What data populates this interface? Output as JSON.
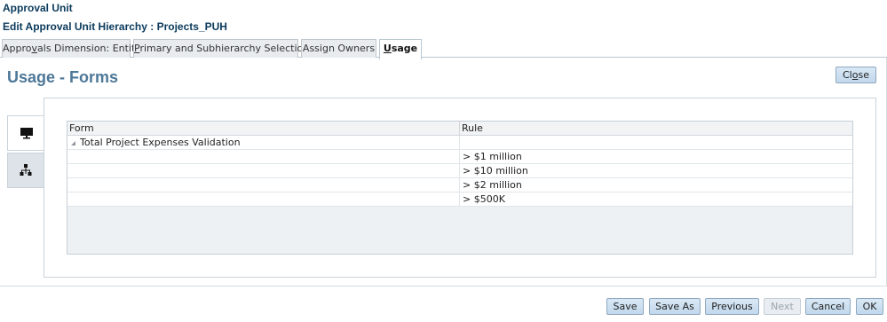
{
  "header": {
    "app_title": "Approval Unit",
    "edit_title": "Edit Approval Unit Hierarchy : Projects_PUH"
  },
  "tabs": [
    {
      "label_pre": "Appro",
      "mnemonic": "v",
      "label_post": "als Dimension: Entity"
    },
    {
      "label_pre": "",
      "mnemonic": "P",
      "label_post": "rimary and Subhierarchy Selection"
    },
    {
      "label_pre": "Assign Owners",
      "mnemonic": "",
      "label_post": ""
    },
    {
      "label_pre": "",
      "mnemonic": "U",
      "label_post": "sage"
    }
  ],
  "main": {
    "heading": "Usage - Forms",
    "close_label_pre": "Cl",
    "close_mnemonic": "o",
    "close_label_post": "se",
    "side_tabs": [
      {
        "icon": "monitor-icon",
        "selected": true
      },
      {
        "icon": "hierarchy-icon",
        "selected": false
      }
    ],
    "grid": {
      "columns": [
        "Form",
        "Rule"
      ],
      "rows": [
        {
          "form": "Total Project Expenses Validation",
          "rule": "",
          "expanded": true
        },
        {
          "form": "",
          "rule": "> $1 million"
        },
        {
          "form": "",
          "rule": "> $10 million"
        },
        {
          "form": "",
          "rule": "> $2 million"
        },
        {
          "form": "",
          "rule": "> $500K"
        }
      ]
    }
  },
  "footer": {
    "save": "Save",
    "save_as": "Save As",
    "previous": "Previous",
    "next": "Next",
    "cancel": "Cancel",
    "ok": "OK"
  },
  "colors": {
    "heading": "#4e7898",
    "title": "#0b3a5c",
    "button_bg": "#c2d8ec",
    "button_border": "#8fa9c0"
  }
}
